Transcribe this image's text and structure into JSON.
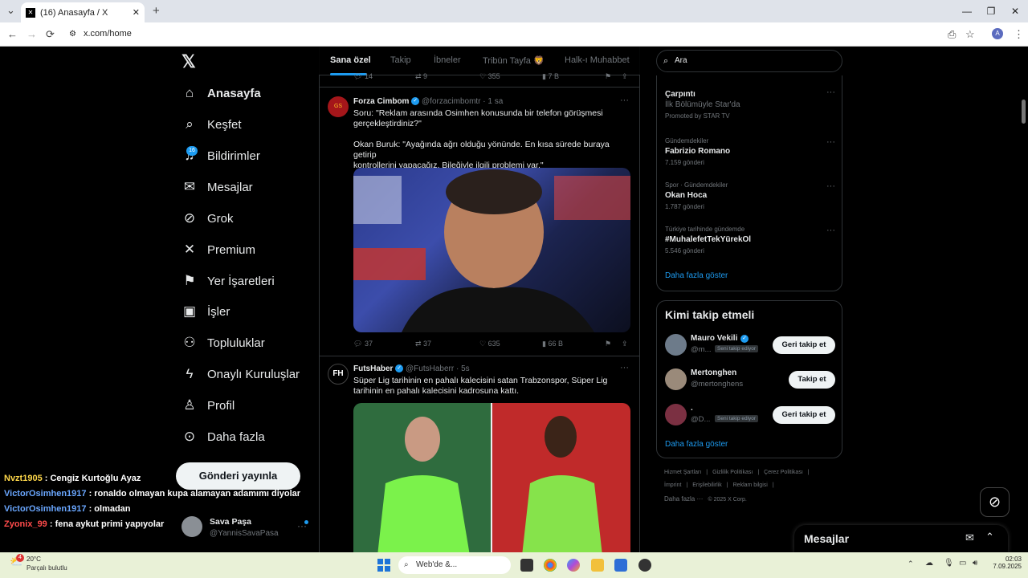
{
  "browser": {
    "tab_title": "(16) Anasayfa / X",
    "url": "x.com/home",
    "new_tab": "+",
    "back": "←",
    "forward": "→",
    "reload": "⟳"
  },
  "nav": {
    "items": [
      {
        "label": "Anasayfa",
        "icon": "home-icon",
        "glyph": "⌂"
      },
      {
        "label": "Keşfet",
        "icon": "search-icon",
        "glyph": "⌕"
      },
      {
        "label": "Bildirimler",
        "icon": "bell-icon",
        "glyph": "♫"
      },
      {
        "label": "Mesajlar",
        "icon": "mail-icon",
        "glyph": "✉"
      },
      {
        "label": "Grok",
        "icon": "grok-icon",
        "glyph": "⊘"
      },
      {
        "label": "Premium",
        "icon": "x-logo-icon",
        "glyph": "✕"
      },
      {
        "label": "Yer İşaretleri",
        "icon": "bookmark-icon",
        "glyph": "⚑"
      },
      {
        "label": "İşler",
        "icon": "briefcase-icon",
        "glyph": "▣"
      },
      {
        "label": "Topluluklar",
        "icon": "people-icon",
        "glyph": "⚇"
      },
      {
        "label": "Onaylı Kuruluşlar",
        "icon": "lightning-icon",
        "glyph": "ϟ"
      },
      {
        "label": "Profil",
        "icon": "profile-icon",
        "glyph": "♙"
      },
      {
        "label": "Daha fazla",
        "icon": "more-circle-icon",
        "glyph": "⊙"
      }
    ],
    "badge": "16",
    "post_button": "Gönderi yayınla",
    "account_name": "Sava Paşa",
    "account_handle": "@YannisSavaPasa"
  },
  "chat": [
    {
      "user": "Nvzt1905",
      "msg": " : Cengiz Kurtoğlu Ayaz"
    },
    {
      "user": "VictorOsimhen1917",
      "msg": " : ronaldo olmayan kupa alamayan adamımı diyolar"
    },
    {
      "user": "VictorOsimhen1917",
      "msg": " : olmadan"
    },
    {
      "user": "Zyonix_99",
      "msg": " : fena aykut primi yapıyolar"
    }
  ],
  "tabs": [
    "Sana özel",
    "Takip",
    "İbneler",
    "Tribün Tayfa 🦁",
    "Halk-ı Muhabbet"
  ],
  "prev_actions": {
    "replies": "14",
    "reposts": "9",
    "likes": "355",
    "views": "7 B"
  },
  "tweet1": {
    "name": "Forza Cimbom",
    "handle": "@forzacimbomtr",
    "time": "· 1 sa",
    "line1": "Soru: \"Reklam arasında Osimhen konusunda bir telefon görüşmesi",
    "line2": "gerçekleştirdiniz?\"",
    "line3": "Okan Buruk: \"Ayağında ağrı olduğu yönünde. En kısa sürede buraya getirip",
    "line4": "kontrollerini yapacağız. Bileğiyle ilgili problemi var.\"",
    "replies": "37",
    "reposts": "37",
    "likes": "635",
    "views": "66 B"
  },
  "tweet2": {
    "name": "FutsHaber",
    "handle": "@FutsHaberr",
    "time": "· 5s",
    "line1": "Süper Lig tarihinin en pahalı kalecisini satan Trabzonspor, Süper Lig",
    "line2": "tarihinin en pahalı kalecisini kadrosuna kattı."
  },
  "search": {
    "placeholder": "Ara"
  },
  "trends": [
    {
      "meta": "",
      "name": "Çarpıntı",
      "sub": "İlk Bölümüyle Star'da",
      "count": "Promoted by STAR TV"
    },
    {
      "meta": "Gündemdekiler",
      "name": "Fabrizio Romano",
      "count": "7.159 gönderi"
    },
    {
      "meta": "Spor · Gündemdekiler",
      "name": "Okan Hoca",
      "count": "1.787 gönderi"
    },
    {
      "meta": "Türkiye tarihinde gündemde",
      "name": "#MuhalefetTekYürekOl",
      "count": "5.546 gönderi"
    }
  ],
  "show_more": "Daha fazla göster",
  "who_to_follow": {
    "title": "Kimi takip etmeli",
    "users": [
      {
        "name": "Mauro Vekili",
        "handle": "@m...",
        "tag": "Seni takip ediyor",
        "button": "Geri takip et"
      },
      {
        "name": "Mertonghen",
        "handle": "@mertonghens",
        "tag": "",
        "button": "Takip et"
      },
      {
        "name": ".",
        "handle": "@D...",
        "tag": "Seni takip ediyor",
        "button": "Geri takip et"
      }
    ],
    "show_more": "Daha fazla göster"
  },
  "footer": {
    "row1": [
      "Hizmet Şartları",
      "|",
      "Gizlilik Politikası",
      "|",
      "Çerez Politikası",
      "|"
    ],
    "row2": [
      "İmprint",
      "|",
      "Erişilebilirlik",
      "|",
      "Reklam bilgisi",
      "|"
    ],
    "row3": [
      "Daha fazla ···",
      "© 2025 X Corp."
    ]
  },
  "messages_dock": "Mesajlar",
  "taskbar": {
    "temp": "20°C",
    "weather": "Parçalı bulutlu",
    "weather_badge": "4",
    "search": "Web'de &...",
    "time": "02:03",
    "date": "7.09.2025"
  }
}
